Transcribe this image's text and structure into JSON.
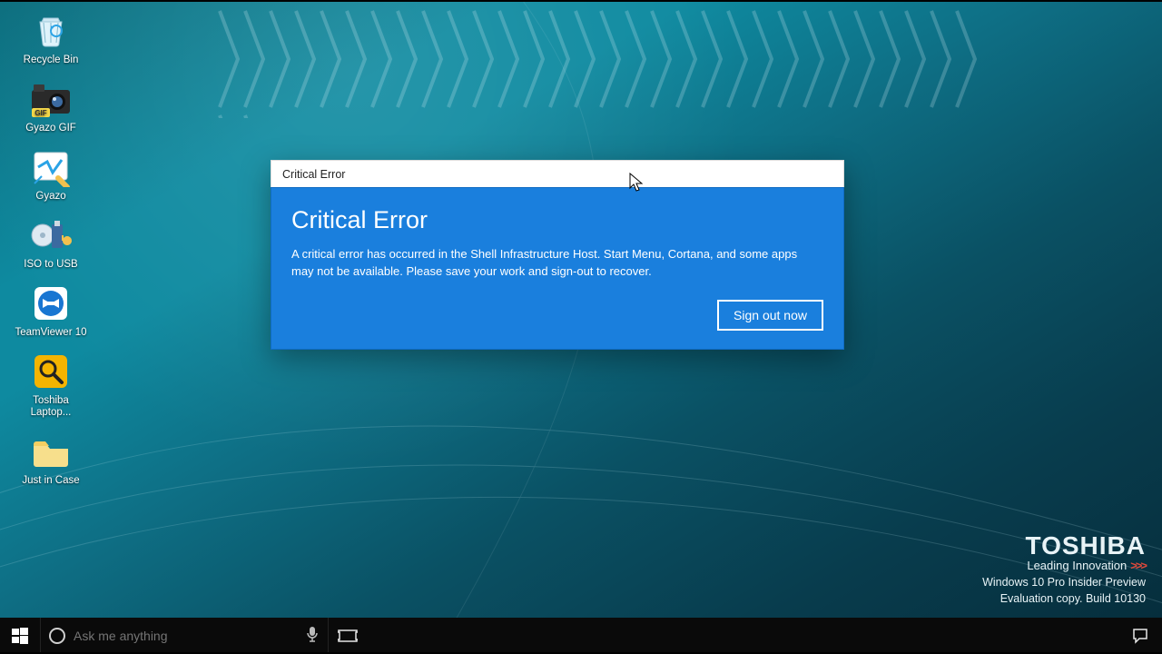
{
  "desktop_icons": [
    {
      "id": "recycle-bin",
      "label": "Recycle Bin"
    },
    {
      "id": "gyazo-gif",
      "label": "Gyazo GIF"
    },
    {
      "id": "gyazo",
      "label": "Gyazo"
    },
    {
      "id": "iso-to-usb",
      "label": "ISO to USB"
    },
    {
      "id": "teamviewer-10",
      "label": "TeamViewer 10"
    },
    {
      "id": "toshiba-laptop",
      "label": "Toshiba Laptop..."
    },
    {
      "id": "just-in-case",
      "label": "Just in Case"
    }
  ],
  "dialog": {
    "window_title": "Critical Error",
    "heading": "Critical Error",
    "message": "A critical error has occurred in the Shell Infrastructure Host. Start Menu, Cortana, and some apps may not be available.  Please save your work and sign-out to recover.",
    "primary_button": "Sign out now"
  },
  "branding": {
    "brand": "TOSHIBA",
    "tagline": "Leading Innovation",
    "line1": "Windows 10 Pro Insider Preview",
    "line2": "Evaluation copy. Build 10130"
  },
  "taskbar": {
    "search_placeholder": "Ask me anything"
  },
  "colors": {
    "dialog_bg": "#1a7fdd",
    "taskbar_bg": "#0a0a0a"
  }
}
